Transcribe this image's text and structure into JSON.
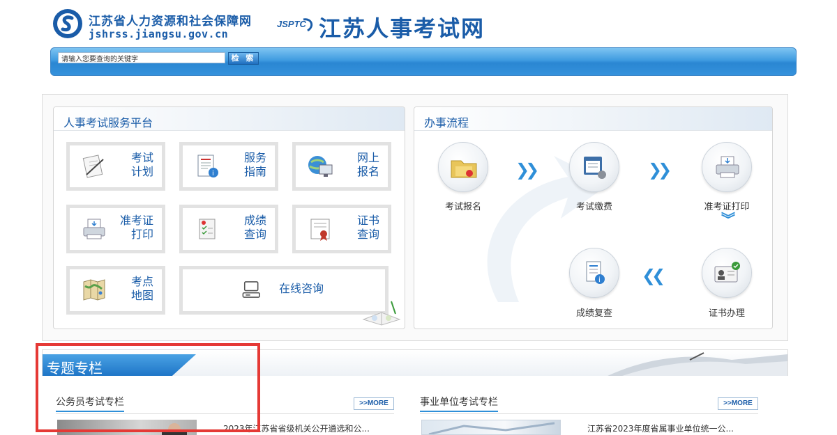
{
  "header": {
    "site_title": "江苏省人力资源和社会保障网",
    "site_url": "jshrss.jiangsu.gov.cn",
    "jsptc_label": "JSPTC",
    "exam_site_title": "江苏人事考试网",
    "brand_color": "#1a5ca8"
  },
  "search": {
    "placeholder": "请输入您要查询的关键字",
    "button_label": "检 索"
  },
  "service_platform": {
    "title": "人事考试服务平台",
    "items": [
      {
        "line1": "考试",
        "line2": "计划",
        "icon": "document-pen-icon"
      },
      {
        "line1": "服务",
        "line2": "指南",
        "icon": "guide-book-icon"
      },
      {
        "line1": "网上",
        "line2": "报名",
        "icon": "globe-computer-icon"
      },
      {
        "line1": "准考证",
        "line2": "打印",
        "icon": "printer-icon"
      },
      {
        "line1": "成绩",
        "line2": "查询",
        "icon": "score-list-icon"
      },
      {
        "line1": "证书",
        "line2": "查询",
        "icon": "certificate-icon"
      },
      {
        "line1": "考点",
        "line2": "地图",
        "icon": "map-icon"
      },
      {
        "label": "在线咨询",
        "icon": "computer-icon"
      }
    ]
  },
  "process": {
    "title": "办事流程",
    "steps": [
      {
        "label": "考试报名",
        "icon": "folder-icon"
      },
      {
        "label": "考试缴费",
        "icon": "payment-window-icon"
      },
      {
        "label": "准考证打印",
        "icon": "printer-icon"
      },
      {
        "label": "证书办理",
        "icon": "id-card-icon"
      },
      {
        "label": "成绩复查",
        "icon": "report-icon"
      }
    ]
  },
  "topics": {
    "title": "专题专栏",
    "columns": [
      {
        "title": "公务员考试专栏",
        "more_label": ">>MORE",
        "first_news": "2023年江苏省省级机关公开遴选和公..."
      },
      {
        "title": "事业单位考试专栏",
        "more_label": ">>MORE",
        "first_news": "江苏省2023年度省属事业单位统一公..."
      }
    ]
  },
  "highlight_color": "#e53935"
}
